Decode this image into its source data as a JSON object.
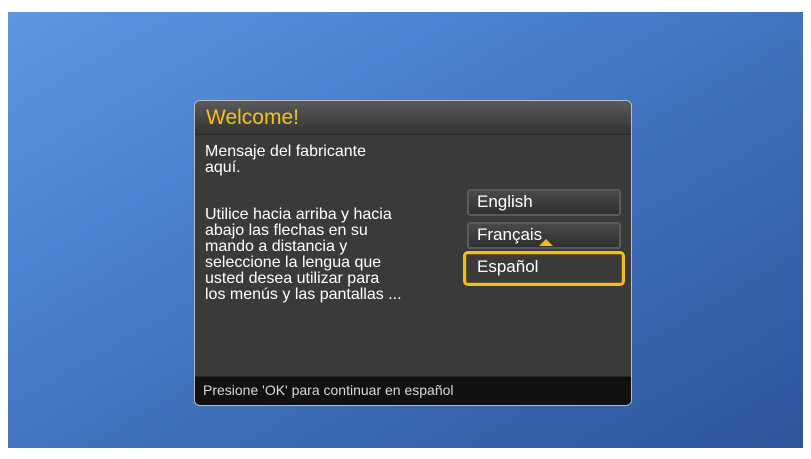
{
  "dialog": {
    "title": "Welcome!",
    "message": "Mensaje del fabricante\naquí.",
    "instructions": "Utilice hacia arriba y hacia\nabajo las flechas en su\nmando a distancia y\nseleccione la lengua que\nusted desea utilizar para\nlos menús y las pantallas ...",
    "footer": "Presione 'OK' para continuar en español"
  },
  "languages": {
    "items": [
      {
        "label": "English",
        "selected": false
      },
      {
        "label": "Français",
        "selected": false
      },
      {
        "label": "Español",
        "selected": true
      }
    ],
    "selected_index": 2
  },
  "colors": {
    "accent": "#f2bd1d",
    "title": "#f2c21b",
    "dialog_background": "#3a3a3a",
    "screen_background": "#4c82cf"
  },
  "icons": {
    "selection_indicator": "up-arrow-icon"
  }
}
